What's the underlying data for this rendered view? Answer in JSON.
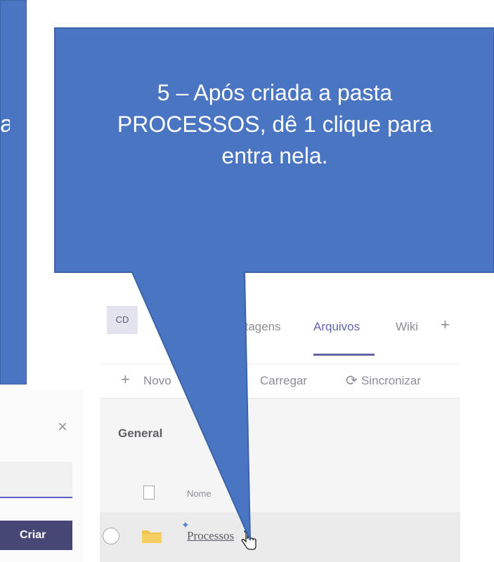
{
  "left_callout": {
    "text": "a"
  },
  "dialog": {
    "close_label": "×",
    "input_value": "",
    "create_label": "Criar"
  },
  "teams": {
    "team_badge": "CD",
    "tabs": [
      {
        "label": "stagens"
      },
      {
        "label": "Arquivos"
      },
      {
        "label": "Wiki"
      },
      {
        "label": "+"
      }
    ],
    "toolbar": {
      "new_icon": "+",
      "new_label": "Novo",
      "upload_label": "Carregar",
      "sync_icon": "⟳",
      "sync_label": "Sincronizar"
    },
    "folder_title": "General",
    "columns": {
      "name": "Nome"
    },
    "rows": [
      {
        "name": "Processos"
      }
    ]
  },
  "callout": {
    "line1": "5 – Após criada a pasta",
    "line2": "PROCESSOS, dê 1 clique para",
    "line3": "entra nela."
  },
  "colors": {
    "callout_blue": "#4a75c2",
    "callout_border": "#3b63a8",
    "teams_accent": "#6264a7",
    "button_dark": "#464775",
    "folder_yellow": "#f2c14e"
  },
  "icons": [
    "close-icon",
    "plus-icon",
    "sync-icon",
    "document-icon",
    "folder-icon",
    "sparkle-icon",
    "hand-cursor-icon",
    "radio-icon"
  ]
}
